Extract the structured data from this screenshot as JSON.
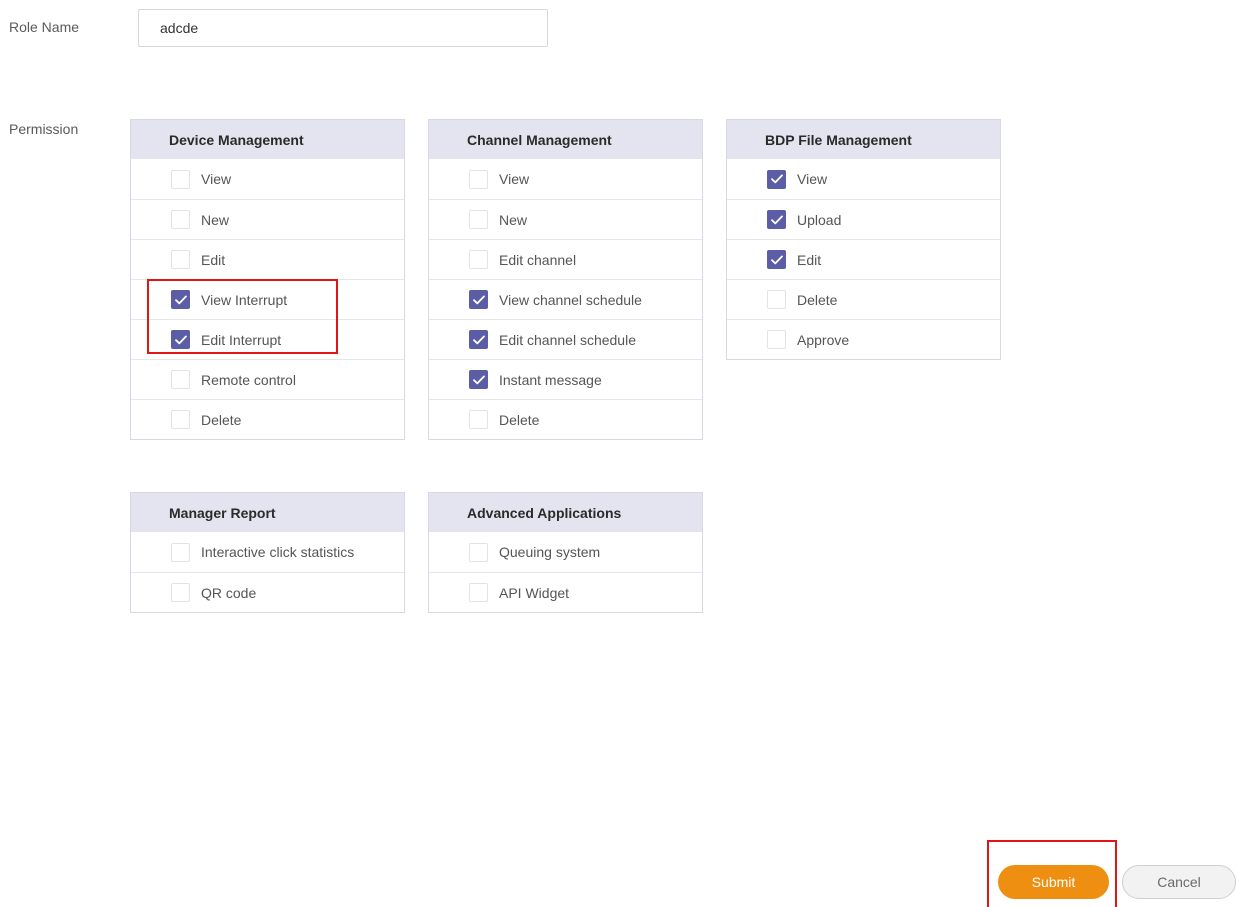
{
  "role_name": {
    "label": "Role Name",
    "value": "adcde"
  },
  "permission": {
    "label": "Permission",
    "panels": [
      {
        "title": "Device Management",
        "items": [
          {
            "label": "View",
            "checked": false
          },
          {
            "label": "New",
            "checked": false
          },
          {
            "label": "Edit",
            "checked": false
          },
          {
            "label": "View Interrupt",
            "checked": true
          },
          {
            "label": "Edit Interrupt",
            "checked": true
          },
          {
            "label": "Remote control",
            "checked": false
          },
          {
            "label": "Delete",
            "checked": false
          }
        ]
      },
      {
        "title": "Channel Management",
        "items": [
          {
            "label": "View",
            "checked": false
          },
          {
            "label": "New",
            "checked": false
          },
          {
            "label": "Edit channel",
            "checked": false
          },
          {
            "label": "View channel schedule",
            "checked": true
          },
          {
            "label": "Edit channel schedule",
            "checked": true
          },
          {
            "label": "Instant message",
            "checked": true
          },
          {
            "label": "Delete",
            "checked": false
          }
        ]
      },
      {
        "title": "BDP File Management",
        "items": [
          {
            "label": "View",
            "checked": true
          },
          {
            "label": "Upload",
            "checked": true
          },
          {
            "label": "Edit",
            "checked": true
          },
          {
            "label": "Delete",
            "checked": false
          },
          {
            "label": "Approve",
            "checked": false
          }
        ]
      },
      {
        "title": "Manager Report",
        "items": [
          {
            "label": "Interactive click statistics",
            "checked": false
          },
          {
            "label": "QR code",
            "checked": false
          }
        ]
      },
      {
        "title": "Advanced Applications",
        "items": [
          {
            "label": "Queuing system",
            "checked": false
          },
          {
            "label": "API Widget",
            "checked": false
          }
        ]
      }
    ]
  },
  "actions": {
    "submit_label": "Submit",
    "cancel_label": "Cancel"
  },
  "colors": {
    "accent": "#5b5ea6",
    "submit": "#ef8f12",
    "header_bg": "#e3e4ef",
    "highlight": "#e01515"
  },
  "icons": {
    "checkbox_mark": "checkmark-icon"
  }
}
